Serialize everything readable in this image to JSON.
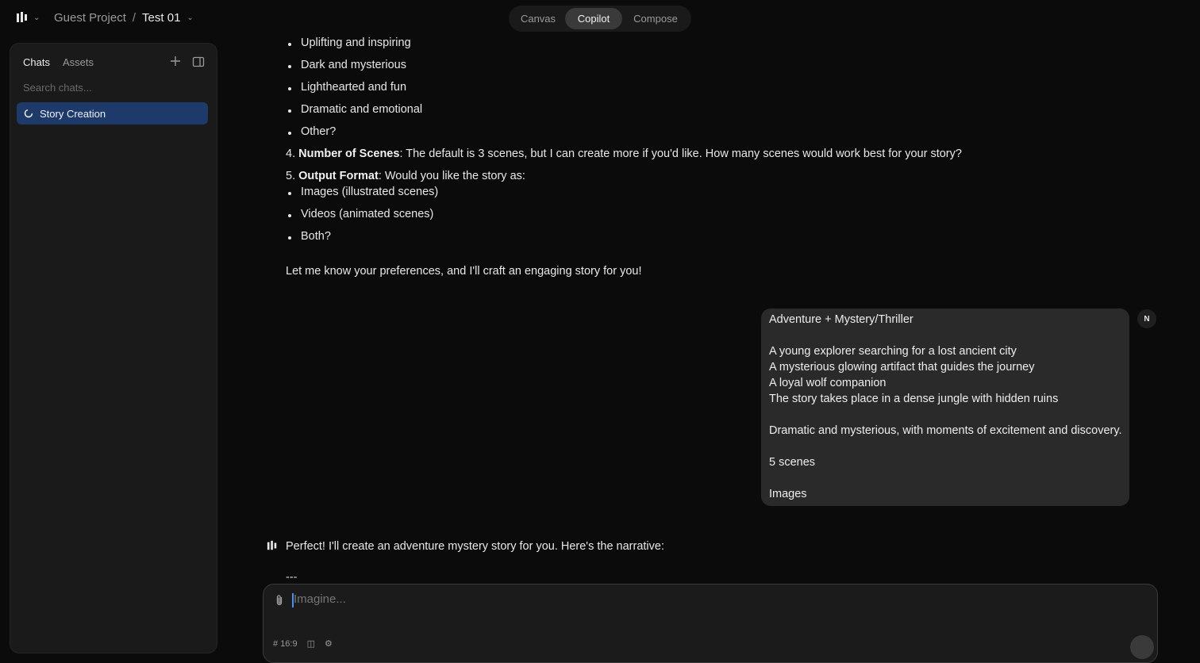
{
  "header": {
    "project": "Guest Project",
    "separator": "/",
    "file": "Test 01",
    "modes": [
      "Canvas",
      "Copilot",
      "Compose"
    ],
    "active_mode": "Copilot"
  },
  "sidebar": {
    "tabs": [
      "Chats",
      "Assets"
    ],
    "search_placeholder": "Search chats...",
    "items": [
      {
        "label": "Story Creation"
      }
    ]
  },
  "assistant_message": {
    "tone_options": [
      "Uplifting and inspiring",
      "Dark and mysterious",
      "Lighthearted and fun",
      "Dramatic and emotional",
      "Other?"
    ],
    "q4_num": "4.",
    "q4_label": "Number of Scenes",
    "q4_text": ": The default is 3 scenes, but I can create more if you'd like. How many scenes would work best for your story?",
    "q5_num": "5.",
    "q5_label": "Output Format",
    "q5_text": ": Would you like the story as:",
    "format_options": [
      "Images (illustrated scenes)",
      "Videos (animated scenes)",
      "Both?"
    ],
    "closing": "Let me know your preferences, and I'll craft an engaging story for you!"
  },
  "user_message": {
    "avatar": "N",
    "lines": [
      "Adventure + Mystery/Thriller",
      "A young explorer searching for a lost ancient city",
      "A mysterious glowing artifact that guides the journey",
      "A loyal wolf companion",
      "The story takes place in a dense jungle with hidden ruins",
      "Dramatic and mysterious, with moments of excitement and discovery.",
      "5 scenes",
      "Images"
    ]
  },
  "reply": {
    "text": "Perfect! I'll create an adventure mystery story for you. Here's the narrative:",
    "divider": "---"
  },
  "composer": {
    "placeholder": "Imagine...",
    "aspect": "16:9"
  }
}
